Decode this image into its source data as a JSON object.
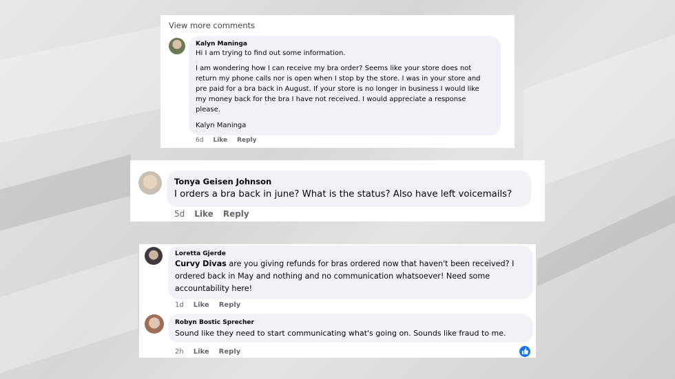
{
  "panel1": {
    "view_more": "View more comments",
    "author": "Kalyn Maninga",
    "lines": [
      "Hi I am trying to find out some information.",
      "I am wondering how I can receive my bra order? Seems like your store does not",
      "return my phone calls nor is open when I stop by the store. I was in your store and",
      "pre paid for a bra back in August. If your store is no longer in business I would like",
      "my money back for the bra I have not received. I would appreciate a response",
      "please.",
      "Kalyn Maninga"
    ],
    "time": "6d",
    "like": "Like",
    "reply": "Reply"
  },
  "panel2": {
    "author": "Tonya Geisen Johnson",
    "text": "I orders a bra back in june? What is the status? Also have left voicemails?",
    "time": "5d",
    "like": "Like",
    "reply": "Reply"
  },
  "panel3": {
    "c1": {
      "author": "Loretta Gjerde",
      "mention": "Curvy Divas",
      "lines": [
        " are you giving refunds for bras ordered now that haven't been received? I",
        "ordered back in May and nothing and no communication whatsoever! Need some",
        "accountability here!"
      ],
      "time": "1d",
      "like": "Like",
      "reply": "Reply"
    },
    "c2": {
      "author": "Robyn Bostic Sprecher",
      "text": "Sound like they need to start communicating what's going on. Sounds like fraud to me.",
      "time": "2h",
      "like": "Like",
      "reply": "Reply"
    }
  },
  "colors": {
    "bubble": "#f0f2f5",
    "like_blue": "#1877f2"
  }
}
